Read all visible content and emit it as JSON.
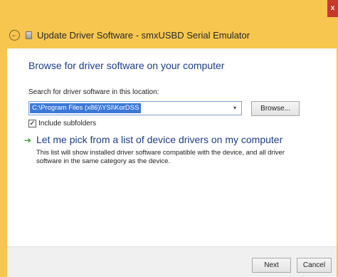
{
  "window": {
    "title": "Update Driver Software - smxUSBD Serial Emulator",
    "close_glyph": "x",
    "back_glyph": "←",
    "accent_color": "#f6c64e"
  },
  "page": {
    "heading": "Browse for driver software on your computer",
    "search_label": "Search for driver software in this location:",
    "path_value": "C:\\Program Files (x86)\\YSI\\KorDSS",
    "dropdown_glyph": "▾",
    "browse_label": "Browse...",
    "include_subfolders_label": "Include subfolders",
    "include_subfolders_checked": true,
    "checkbox_glyph": "✓",
    "pick_arrow_glyph": "➔",
    "pick_title": "Let me pick from a list of device drivers on my computer",
    "pick_description": "This list will show installed driver software compatible with the device, and all driver software in the same category as the device."
  },
  "footer": {
    "next_label": "Next",
    "cancel_label": "Cancel"
  }
}
